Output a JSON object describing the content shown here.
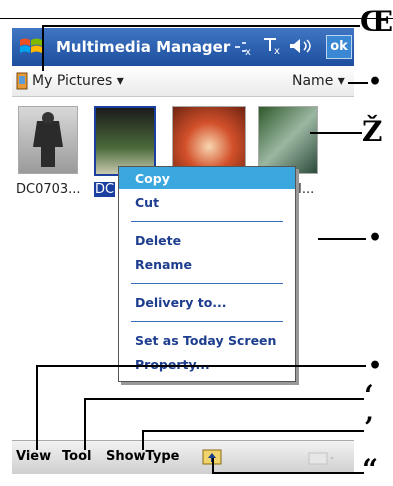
{
  "titlebar": {
    "title": "Multimedia Manager",
    "ok_label": "ok"
  },
  "folderbar": {
    "folder_label": "My Pictures ▾",
    "sort_label": "Name ▾"
  },
  "thumbnails": [
    {
      "label": "DC0703..."
    },
    {
      "label": "DC"
    },
    {
      "label": ""
    },
    {
      "label": "I..."
    }
  ],
  "context_menu": {
    "items": [
      "Copy",
      "Cut",
      "Delete",
      "Rename",
      "Delivery to...",
      "Set as Today Screen",
      "Property..."
    ]
  },
  "bottombar": {
    "view": "View",
    "tool": "Tool",
    "showtype": "ShowType"
  },
  "callouts": {
    "c1": "Œ",
    "c2": "•",
    "c3": "Ž",
    "c4": "•",
    "c5": "•",
    "c6": "‘",
    "c7": "’",
    "c8": "“"
  }
}
